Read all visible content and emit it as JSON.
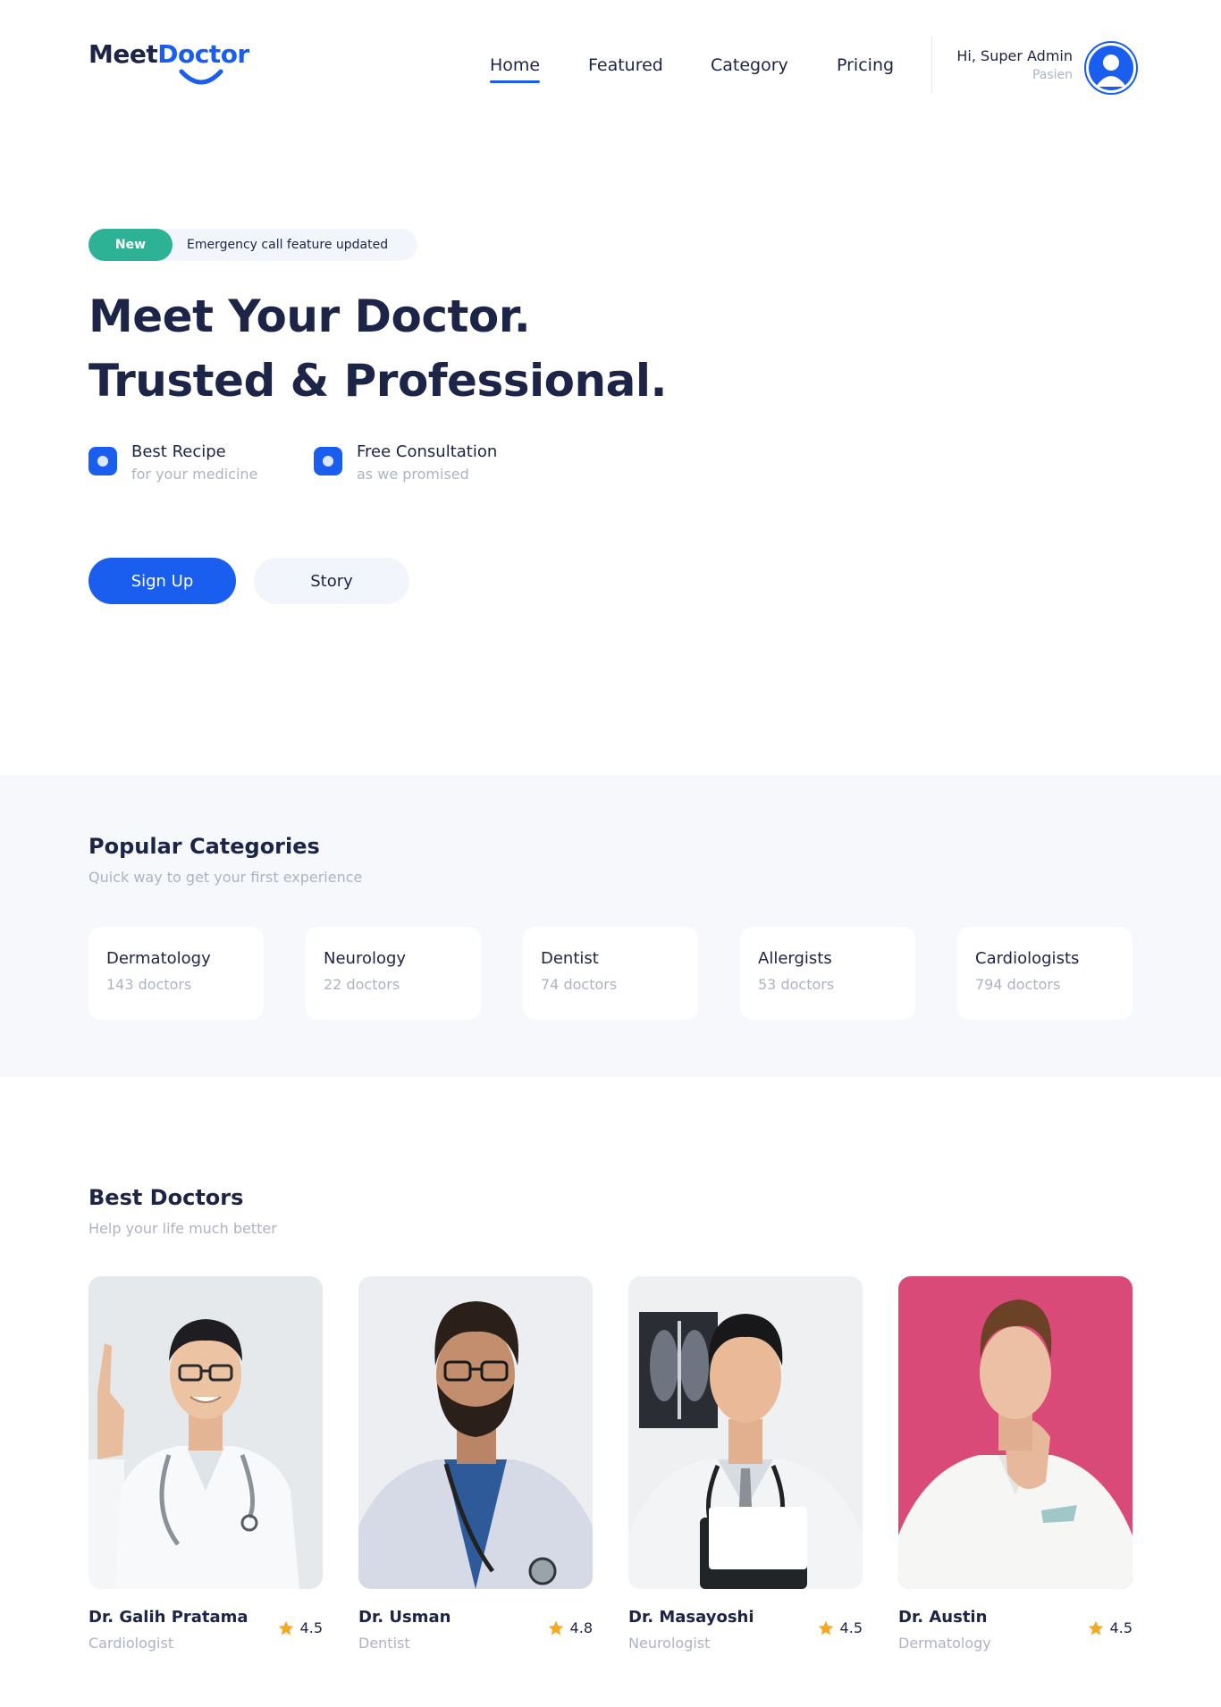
{
  "brand": {
    "name_part1": "Meet",
    "name_part2": "Doctor",
    "primary_color": "#1a5ef0",
    "dark_color": "#1c2447",
    "accent_green": "#2db295"
  },
  "nav": {
    "items": [
      {
        "label": "Home",
        "active": true
      },
      {
        "label": "Featured",
        "active": false
      },
      {
        "label": "Category",
        "active": false
      },
      {
        "label": "Pricing",
        "active": false
      }
    ]
  },
  "user": {
    "greeting": "Hi, Super Admin",
    "role": "Pasien",
    "avatar_icon": "user-avatar-icon"
  },
  "hero": {
    "badge_tag": "New",
    "badge_text": "Emergency call feature updated",
    "title_line1": "Meet Your Doctor.",
    "title_line2": "Trusted & Professional.",
    "features": [
      {
        "title": "Best Recipe",
        "subtitle": "for your medicine"
      },
      {
        "title": "Free Consultation",
        "subtitle": "as we promised"
      }
    ],
    "primary_button": "Sign Up",
    "secondary_button": "Story"
  },
  "categories": {
    "title": "Popular Categories",
    "subtitle": "Quick way to get your first experience",
    "items": [
      {
        "name": "Dermatology",
        "count": "143 doctors"
      },
      {
        "name": "Neurology",
        "count": "22 doctors"
      },
      {
        "name": "Dentist",
        "count": "74 doctors"
      },
      {
        "name": "Allergists",
        "count": "53 doctors"
      },
      {
        "name": "Cardiologists",
        "count": "794 doctors"
      }
    ]
  },
  "doctors": {
    "title": "Best Doctors",
    "subtitle": "Help your life much better",
    "items": [
      {
        "name": "Dr. Galih Pratama",
        "specialty": "Cardiologist",
        "rating": "4.5",
        "bg": "#e9ecef"
      },
      {
        "name": "Dr. Usman",
        "specialty": "Dentist",
        "rating": "4.8",
        "bg": "#eceef1"
      },
      {
        "name": "Dr. Masayoshi",
        "specialty": "Neurologist",
        "rating": "4.5",
        "bg": "#eef0f2"
      },
      {
        "name": "Dr. Austin",
        "specialty": "Dermatology",
        "rating": "4.5",
        "bg": "#d94a79"
      }
    ],
    "star_color": "#f7a823"
  }
}
